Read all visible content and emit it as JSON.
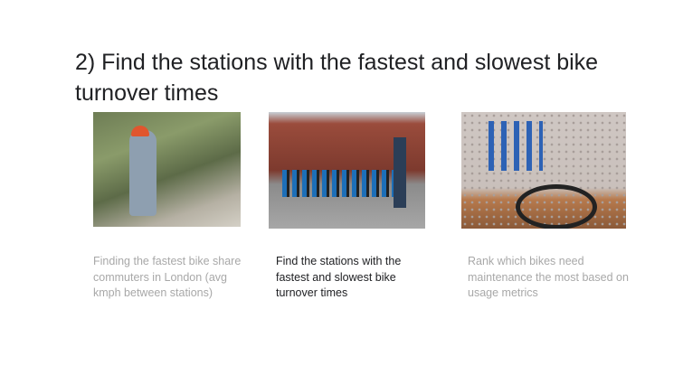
{
  "slide": {
    "title": "2) Find the stations with the fastest and slowest bike turnover times",
    "options": [
      {
        "caption": "Finding the fastest bike share commuters in London (avg kmph between stations)",
        "image": "cyclists-on-path",
        "active": false
      },
      {
        "caption": "Find the stations with the fastest and slowest bike turnover times",
        "image": "bike-docking-station",
        "active": true
      },
      {
        "caption": "Rank which bikes need maintenance the most based on usage metrics",
        "image": "bike-repair-tools",
        "active": false
      }
    ]
  }
}
